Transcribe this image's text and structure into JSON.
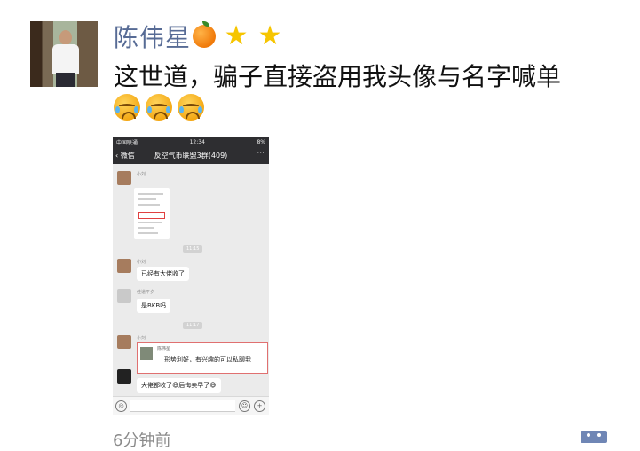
{
  "post": {
    "author_name": "陈伟星",
    "author_emojis": [
      "orange-emoji",
      "star-emoji",
      "star-emoji"
    ],
    "text": "这世道，骗子直接盗用我头像与名字喊单",
    "reaction_emojis": [
      "crying-face-emoji",
      "crying-face-emoji",
      "crying-face-emoji"
    ],
    "time_ago": "6分钟前"
  },
  "screenshot": {
    "status": {
      "carrier": "中国联通",
      "time": "12:34",
      "battery": "8%"
    },
    "nav": {
      "back_label": "微信",
      "title": "反空气币联盟3群(409)",
      "more": "···"
    },
    "messages": [
      {
        "sender": "小刘",
        "type": "image"
      },
      {
        "time": "11:15"
      },
      {
        "sender": "小刘",
        "text": "已经有大佬收了"
      },
      {
        "sender": "佳道平夕",
        "text": "是BKB吗"
      },
      {
        "time": "11:17"
      },
      {
        "sender": "小刘",
        "quote_name": "陈伟星",
        "quote_text": "形势利好，有兴趣的可以私聊我"
      },
      {
        "text": "大佬都收了😅后悔卖早了😅"
      }
    ],
    "input": {
      "voice_icon": "voice-icon",
      "emoji_icon": "emoji-icon",
      "plus_icon": "plus-icon"
    }
  },
  "colors": {
    "name_blue": "#576b95",
    "nav_dark": "#2e2e31",
    "chat_bg": "#ebebeb",
    "highlight_red": "#e04040"
  }
}
